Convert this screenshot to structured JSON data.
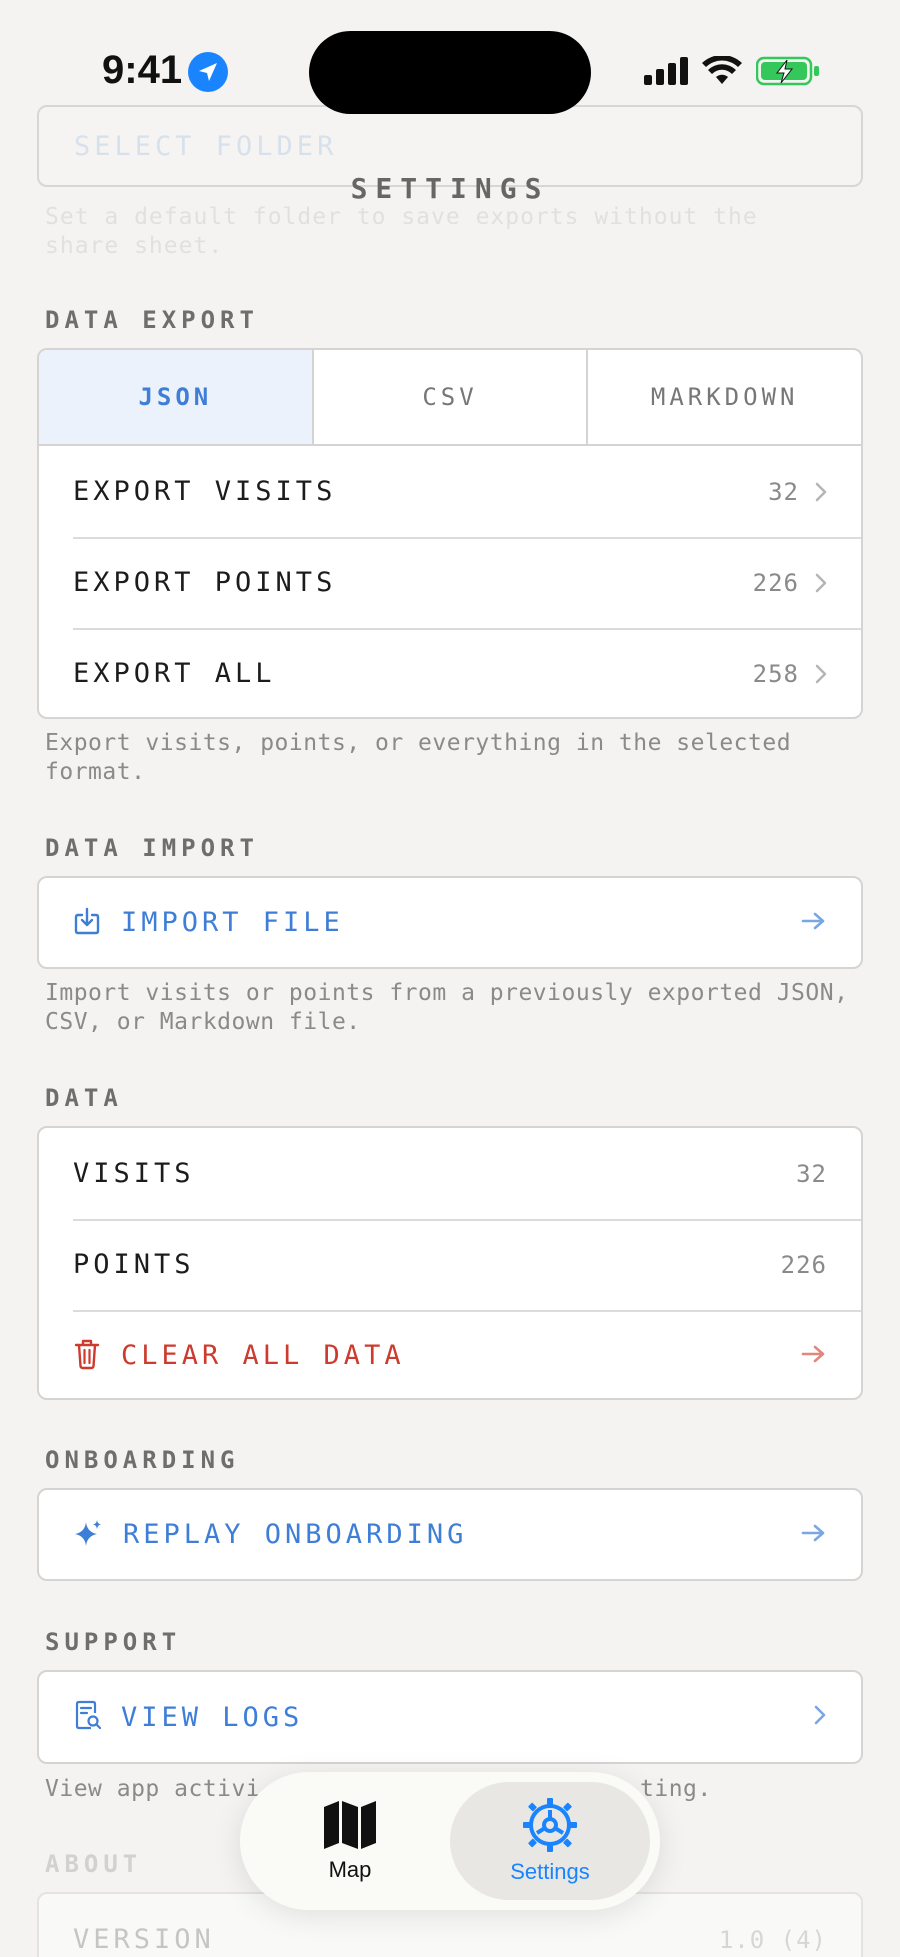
{
  "status_bar": {
    "time": "9:41"
  },
  "ghost": {
    "folder_button": "SELECT FOLDER",
    "folder_footnote": "Set a default folder to save exports without the share sheet."
  },
  "page_title": "SETTINGS",
  "data_export": {
    "label": "DATA EXPORT",
    "formats": [
      "JSON",
      "CSV",
      "MARKDOWN"
    ],
    "selected_format": "JSON",
    "rows": [
      {
        "label": "EXPORT VISITS",
        "count": "32"
      },
      {
        "label": "EXPORT POINTS",
        "count": "226"
      },
      {
        "label": "EXPORT ALL",
        "count": "258"
      }
    ],
    "footnote": "Export visits, points, or everything in the selected format."
  },
  "data_import": {
    "label": "DATA IMPORT",
    "button": "IMPORT FILE",
    "footnote": "Import visits or points from a previously exported JSON, CSV, or Markdown file."
  },
  "data": {
    "label": "DATA",
    "rows": [
      {
        "label": "VISITS",
        "value": "32"
      },
      {
        "label": "POINTS",
        "value": "226"
      }
    ],
    "clear": "CLEAR ALL DATA"
  },
  "onboarding": {
    "label": "ONBOARDING",
    "button": "REPLAY ONBOARDING"
  },
  "support": {
    "label": "SUPPORT",
    "button": "VIEW LOGS",
    "footnote_left": "View app activi",
    "footnote_right": "ting."
  },
  "about": {
    "label": "ABOUT",
    "version_label": "VERSION",
    "version_value": "1.0 (4)"
  },
  "tabs": [
    {
      "label": "Map"
    },
    {
      "label": "Settings"
    }
  ],
  "colors": {
    "accent": "#3f7ed6",
    "danger": "#cc3b2e",
    "tab_active": "#1a84ff"
  }
}
